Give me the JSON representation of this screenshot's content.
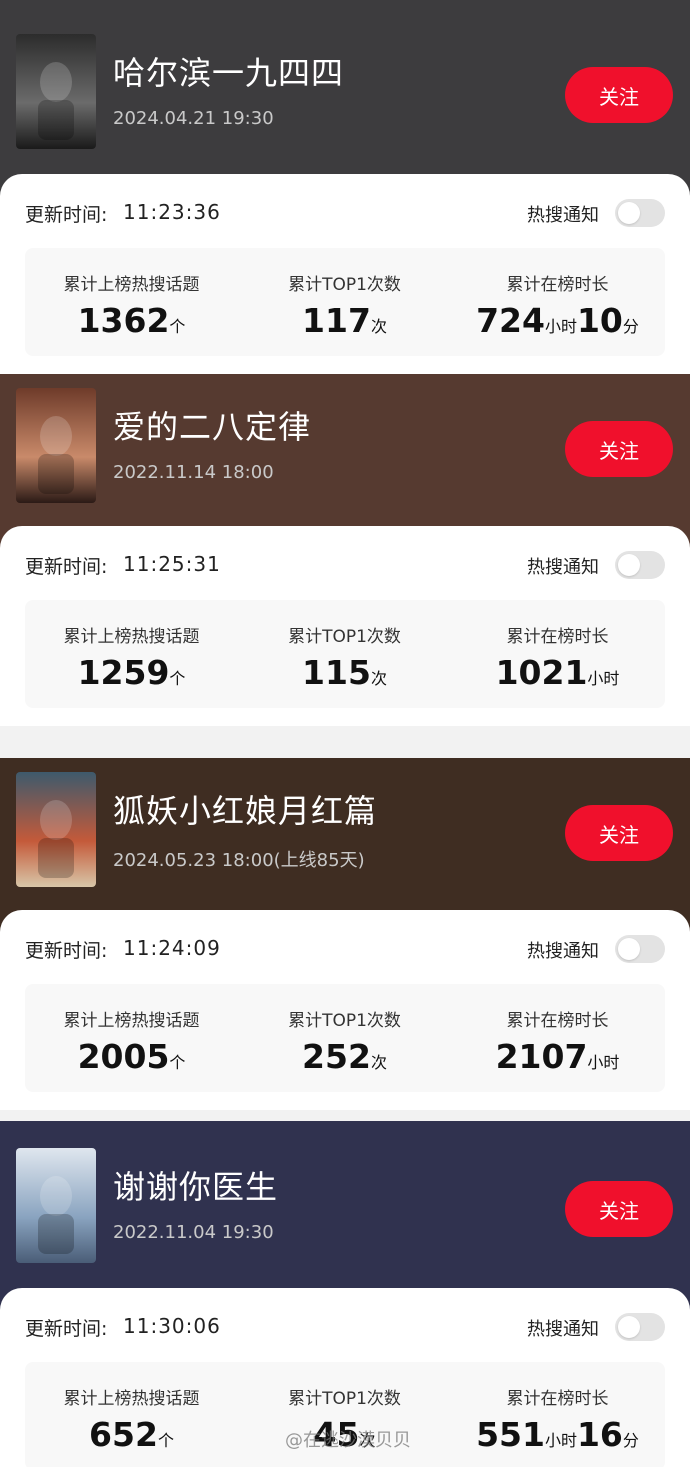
{
  "entries": [
    {
      "title": "哈尔滨一九四四",
      "date": "2024.04.21 19:30",
      "follow_label": "关注",
      "bg": "#3d3c3e",
      "update_label": "更新时间:",
      "update_time": "11:23:36",
      "notify_label": "热搜通知",
      "stats": [
        {
          "label": "累计上榜热搜话题",
          "parts": [
            {
              "n": "1362",
              "u": "个"
            }
          ]
        },
        {
          "label": "累计TOP1次数",
          "parts": [
            {
              "n": "117",
              "u": "次"
            }
          ]
        },
        {
          "label": "累计在榜时长",
          "parts": [
            {
              "n": "724",
              "u": "小时"
            },
            {
              "n": "10",
              "u": "分"
            }
          ]
        }
      ]
    },
    {
      "title": "爱的二八定律",
      "date": "2022.11.14 18:00",
      "follow_label": "关注",
      "bg": "#563a30",
      "update_label": "更新时间:",
      "update_time": "11:25:31",
      "notify_label": "热搜通知",
      "stats": [
        {
          "label": "累计上榜热搜话题",
          "parts": [
            {
              "n": "1259",
              "u": "个"
            }
          ]
        },
        {
          "label": "累计TOP1次数",
          "parts": [
            {
              "n": "115",
              "u": "次"
            }
          ]
        },
        {
          "label": "累计在榜时长",
          "parts": [
            {
              "n": "1021",
              "u": "小时"
            }
          ]
        }
      ]
    },
    {
      "title": "狐妖小红娘月红篇",
      "date": "2024.05.23 18:00(上线85天)",
      "follow_label": "关注",
      "bg": "#3f2d22",
      "update_label": "更新时间:",
      "update_time": "11:24:09",
      "notify_label": "热搜通知",
      "stats": [
        {
          "label": "累计上榜热搜话题",
          "parts": [
            {
              "n": "2005",
              "u": "个"
            }
          ]
        },
        {
          "label": "累计TOP1次数",
          "parts": [
            {
              "n": "252",
              "u": "次"
            }
          ]
        },
        {
          "label": "累计在榜时长",
          "parts": [
            {
              "n": "2107",
              "u": "小时"
            }
          ]
        }
      ]
    },
    {
      "title": "谢谢你医生",
      "date": "2022.11.04 19:30",
      "follow_label": "关注",
      "bg": "#30324f",
      "update_label": "更新时间:",
      "update_time": "11:30:06",
      "notify_label": "热搜通知",
      "stats": [
        {
          "label": "累计上榜热搜话题",
          "parts": [
            {
              "n": "652",
              "u": "个"
            }
          ]
        },
        {
          "label": "累计TOP1次数",
          "parts": [
            {
              "n": "45",
              "u": "次"
            }
          ]
        },
        {
          "label": "累计在榜时长",
          "parts": [
            {
              "n": "551",
              "u": "小时"
            },
            {
              "n": "16",
              "u": "分"
            }
          ]
        }
      ]
    }
  ],
  "watermark": "@在逃沙漠贝贝",
  "colors": {
    "accent": "#f0102c",
    "toggle_off": "#e3e3e3"
  }
}
